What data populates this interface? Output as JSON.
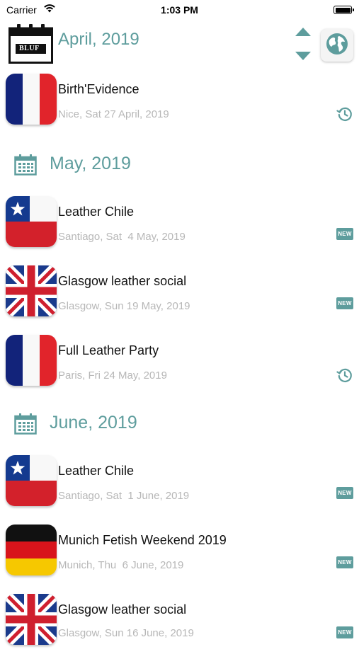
{
  "status_bar": {
    "carrier": "Carrier",
    "time": "1:03 PM"
  },
  "header": {
    "month": "April, 2019",
    "logo_text": "BLUF"
  },
  "colors": {
    "accent": "#5e9d9d",
    "subtitle": "#b7b7b7"
  },
  "sections": [
    {
      "month": "May, 2019"
    },
    {
      "month": "June, 2019"
    }
  ],
  "events": [
    {
      "title": "Birth'Evidence",
      "subtitle": "Nice, Sat 27 April, 2019",
      "flag": "france",
      "status": "history-icon"
    },
    {
      "title": "Leather Chile",
      "subtitle": "Santiago, Sat  4 May, 2019",
      "flag": "chile",
      "status": "NEW"
    },
    {
      "title": "Glasgow leather social",
      "subtitle": "Glasgow, Sun 19 May, 2019",
      "flag": "uk",
      "status": "NEW"
    },
    {
      "title": "Full Leather Party",
      "subtitle": "Paris, Fri 24 May, 2019",
      "flag": "france",
      "status": "history-icon",
      "attending": true
    },
    {
      "title": "Leather Chile",
      "subtitle": "Santiago, Sat  1 June, 2019",
      "flag": "chile",
      "status": "NEW"
    },
    {
      "title": "Munich Fetish Weekend 2019",
      "subtitle": "Munich, Thu  6 June, 2019",
      "flag": "germany",
      "status": "NEW"
    },
    {
      "title": "Glasgow leather social",
      "subtitle": "Glasgow, Sun 16 June, 2019",
      "flag": "uk",
      "status": "NEW"
    }
  ]
}
